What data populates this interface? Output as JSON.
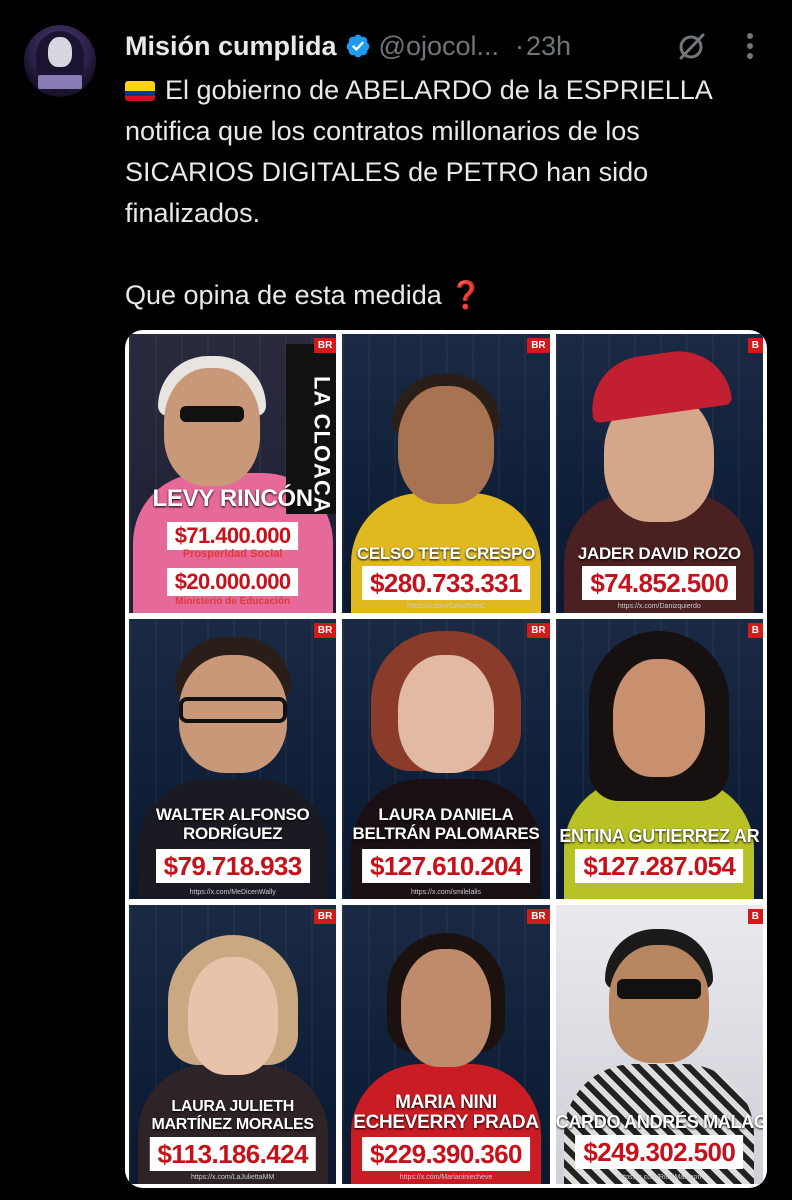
{
  "tweet": {
    "author_name": "Misión cumplida",
    "handle": "@ojocol...",
    "separator": "·",
    "time": "23h",
    "text_line1": "El gobierno de ABELARDO de la ESPRIELLA notifica que los contratos millonarios de los SICARIOS DIGITALES de PETRO han sido finalizados.",
    "text_line2": "Que opina de esta medida",
    "emoji_flag": "colombia-flag-icon",
    "emoji_question": "❓"
  },
  "cards": [
    {
      "name": "LEVY RINCÓN",
      "amount1": "$71.400.000",
      "label1": "Prosperidad Social",
      "amount2": "$20.000.000",
      "label2": "Ministerio de Educación",
      "overlay": "LA CLOACA",
      "badge": "BR",
      "url": ""
    },
    {
      "name": "CELSO TETE CRESPO",
      "amount": "$280.733.331",
      "badge": "BR",
      "url": "https://x.com/CelsoTeteC"
    },
    {
      "name": "JADER DAVID ROZO",
      "amount": "$74.852.500",
      "badge": "B",
      "url": "https://x.com/Danizquierdo"
    },
    {
      "name_line1": "WALTER ALFONSO",
      "name_line2": "RODRÍGUEZ",
      "amount": "$79.718.933",
      "badge": "BR",
      "url": "https://x.com/MeDicenWally"
    },
    {
      "name_line1": "LAURA DANIELA",
      "name_line2": "BELTRÁN PALOMARES",
      "amount": "$127.610.204",
      "badge": "BR",
      "url": "https://x.com/smilelalis"
    },
    {
      "name": "ENTINA GUTIERREZ AR",
      "amount": "$127.287.054",
      "badge": "B",
      "url": ""
    },
    {
      "name_line1": "LAURA JULIETH",
      "name_line2": "MARTÍNEZ MORALES",
      "amount": "$113.186.424",
      "badge": "BR",
      "url": "https://x.com/LaJuliettaMM"
    },
    {
      "name_line1": "MARIA NINI",
      "name_line2": "ECHEVERRY PRADA",
      "amount": "$229.390.360",
      "badge": "BR",
      "url": "https://x.com/Marianiniecheve"
    },
    {
      "name": "CARDO ANDRÉS MALAG",
      "amount": "$249.302.500",
      "badge": "B",
      "url": "https://x.com/RichiMalagon"
    }
  ]
}
